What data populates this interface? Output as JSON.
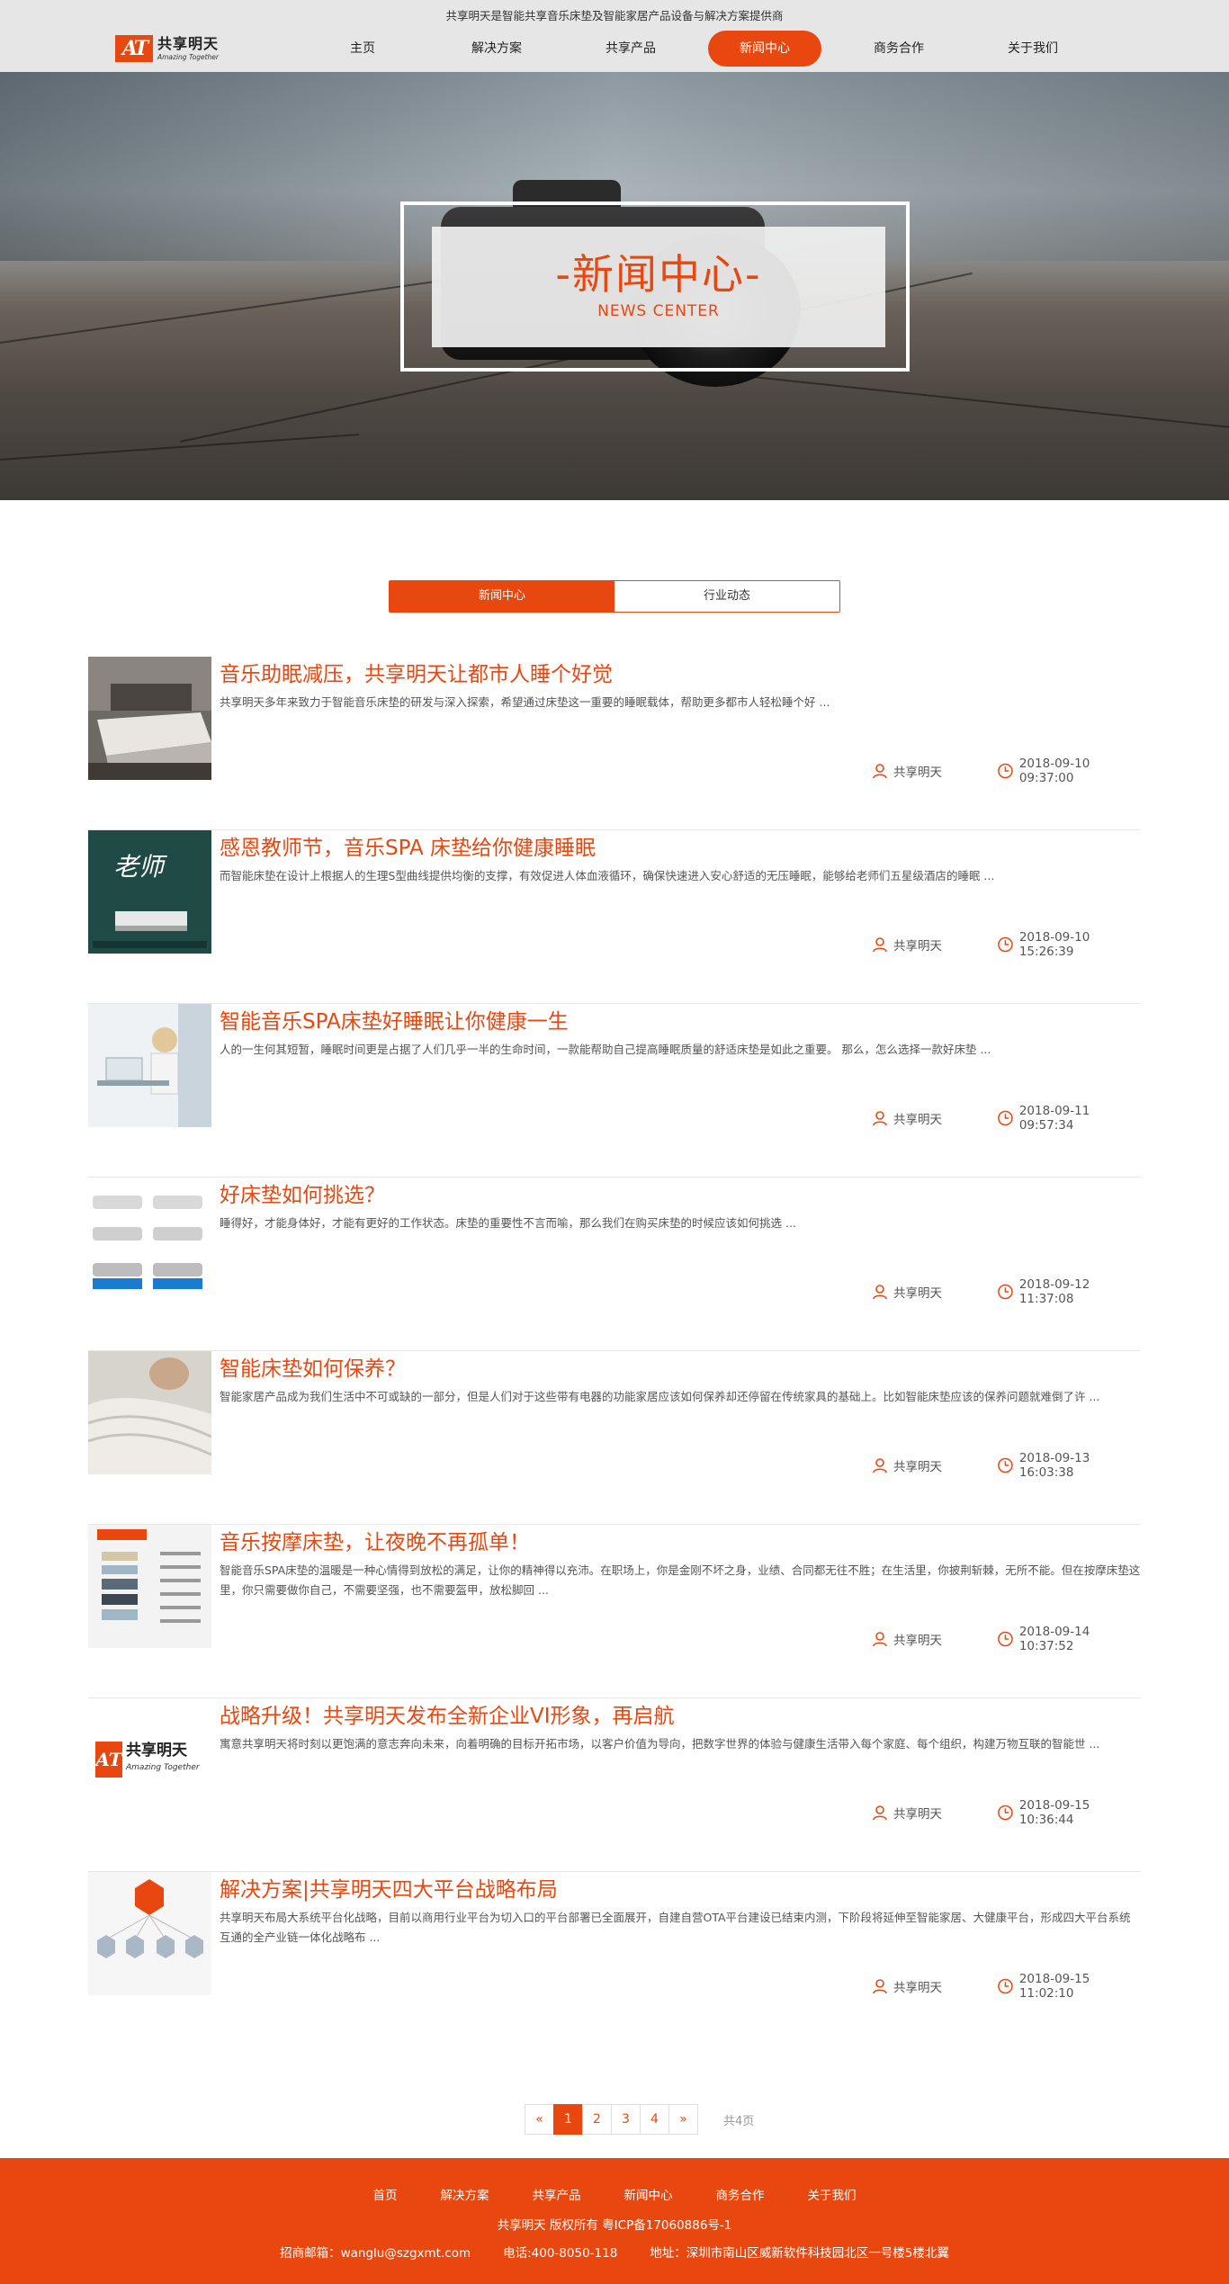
{
  "header": {
    "tagline": "共享明天是智能共享音乐床垫及智能家居产品设备与解决方案提供商",
    "logo_mark": "AT",
    "logo_cn": "共享明天",
    "logo_en": "Amazing Together",
    "nav": [
      "主页",
      "解决方案",
      "共享产品",
      "新闻中心",
      "商务合作",
      "关于我们"
    ],
    "active_nav": "新闻中心"
  },
  "banner": {
    "title": "-新闻中心-",
    "subtitle": "NEWS CENTER"
  },
  "tabs": [
    "新闻中心",
    "行业动态"
  ],
  "news": [
    {
      "title": "音乐助眠减压，共享明天让都市人睡个好觉",
      "desc": "共享明天多年来致力于智能音乐床垫的研发与深入探索，希望通过床垫这一重要的睡眠载体，帮助更多都市人轻松睡个好    ...",
      "author": "共享明天",
      "time": "2018-09-10 09:37:00"
    },
    {
      "title": "感恩教师节，音乐SPA 床垫给你健康睡眠",
      "desc": "而智能床垫在设计上根据人的生理S型曲线提供均衡的支撑，有效促进人体血液循环，确保快速进入安心舒适的无压睡眠，能够给老师们五星级酒店的睡眠    ...",
      "author": "共享明天",
      "time": "2018-09-10 15:26:39"
    },
    {
      "title": "智能音乐SPA床垫好睡眠让你健康一生",
      "desc": "人的一生何其短暂，睡眠时间更是占据了人们几乎一半的生命时间，一款能帮助自己提高睡眠质量的舒适床垫是如此之重要。 那么，怎么选择一款好床垫    ...",
      "author": "共享明天",
      "time": "2018-09-11 09:57:34"
    },
    {
      "title": "好床垫如何挑选？",
      "desc": "睡得好，才能身体好，才能有更好的工作状态。床垫的重要性不言而喻，那么我们在购买床垫的时候应该如何挑选    ...",
      "author": "共享明天",
      "time": "2018-09-12 11:37:08"
    },
    {
      "title": "智能床垫如何保养？",
      "desc": "智能家居产品成为我们生活中不可或缺的一部分，但是人们对于这些带有电器的功能家居应该如何保养却还停留在传统家具的基础上。比如智能床垫应该的保养问题就难倒了许    ...",
      "author": "共享明天",
      "time": "2018-09-13 16:03:38"
    },
    {
      "title": "音乐按摩床垫，让夜晚不再孤单！",
      "desc": "智能音乐SPA床垫的温暖是一种心情得到放松的满足，让你的精神得以充沛。在职场上，你是金刚不坏之身，业绩、合同都无往不胜；在生活里，你披荆斩棘，无所不能。但在按摩床垫这里，你只需要做你自己，不需要坚强，也不需要盔甲，放松脚回    ...",
      "author": "共享明天",
      "time": "2018-09-14 10:37:52"
    },
    {
      "title": "战略升级！共享明天发布全新企业VI形象，再启航",
      "desc": "寓意共享明天将时刻以更饱满的意志奔向未来，向着明确的目标开拓市场，以客户价值为导向，把数字世界的体验与健康生活带入每个家庭、每个组织，构建万物互联的智能世    ...",
      "author": "共享明天",
      "time": "2018-09-15 10:36:44"
    },
    {
      "title": "解决方案|共享明天四大平台战略布局",
      "desc": "共享明天布局大系统平台化战略，目前以商用行业平台为切入口的平台部署已全面展开，自建自营OTA平台建设已结束内测，下阶段将延伸至智能家居、大健康平台，形成四大平台系统互通的全产业链一体化战略布    ...",
      "author": "共享明天",
      "time": "2018-09-15 11:02:10"
    }
  ],
  "pagination": {
    "prev": "«",
    "pages": [
      "1",
      "2",
      "3",
      "4"
    ],
    "current": "1",
    "next": "»",
    "total": "共4页"
  },
  "footer": {
    "nav": [
      "首页",
      "解决方案",
      "共享产品",
      "新闻中心",
      "商务合作",
      "关于我们"
    ],
    "copyright": "共享明天 版权所有 粤ICP备17060886号-1",
    "email": "招商邮箱：wanglu@szgxmt.com",
    "phone": "电话:400-8050-118",
    "address": "地址：深圳市南山区威新软件科技园北区一号楼5楼北翼"
  },
  "colors": {
    "accent": "#e8480f",
    "header_bg": "#e6e6e6"
  },
  "icons": {
    "author": "user-icon",
    "time": "clock-icon"
  }
}
